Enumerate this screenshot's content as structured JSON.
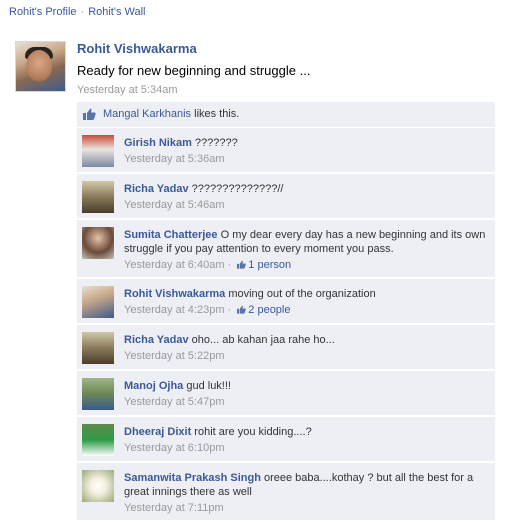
{
  "breadcrumb": {
    "profile": "Rohit's Profile",
    "separator": "·",
    "wall": "Rohit's Wall"
  },
  "post": {
    "author": "Rohit Vishwakarma",
    "message": "Ready for new beginning and struggle ...",
    "time": "Yesterday at 5:34am"
  },
  "likes": {
    "icon": "thumbs-up-icon",
    "liker": "Mangal Karkhanis",
    "suffix": " likes this."
  },
  "comments": [
    {
      "author": "Girish Nikam",
      "text": " ???????",
      "time": "Yesterday at 5:36am",
      "likes": ""
    },
    {
      "author": "Richa Yadav",
      "text": " ??????????????//",
      "time": "Yesterday at 5:46am",
      "likes": ""
    },
    {
      "author": "Sumita Chatterjee",
      "text": " O my dear every day has a new beginning and its own struggle if you pay attention to every moment you pass.",
      "time": "Yesterday at 6:40am",
      "likes": "1 person"
    },
    {
      "author": "Rohit Vishwakarma",
      "text": " moving out of the organization",
      "time": "Yesterday at 4:23pm",
      "likes": "2 people"
    },
    {
      "author": "Richa Yadav",
      "text": " oho... ab kahan jaa rahe ho...",
      "time": "Yesterday at 5:22pm",
      "likes": ""
    },
    {
      "author": "Manoj Ojha",
      "text": " gud luk!!!",
      "time": "Yesterday at 5:47pm",
      "likes": ""
    },
    {
      "author": "Dheeraj Dixit",
      "text": " rohit are you kidding....?",
      "time": "Yesterday at 6:10pm",
      "likes": ""
    },
    {
      "author": "Samanwita Prakash Singh",
      "text": " oreee baba....kothay ? but all the best for a great innings there as well",
      "time": "Yesterday at 7:11pm",
      "likes": ""
    }
  ],
  "meta_separator": " · ",
  "colors": {
    "link": "#3b5998",
    "ufi_background": "#edeff4",
    "muted": "#999999"
  }
}
